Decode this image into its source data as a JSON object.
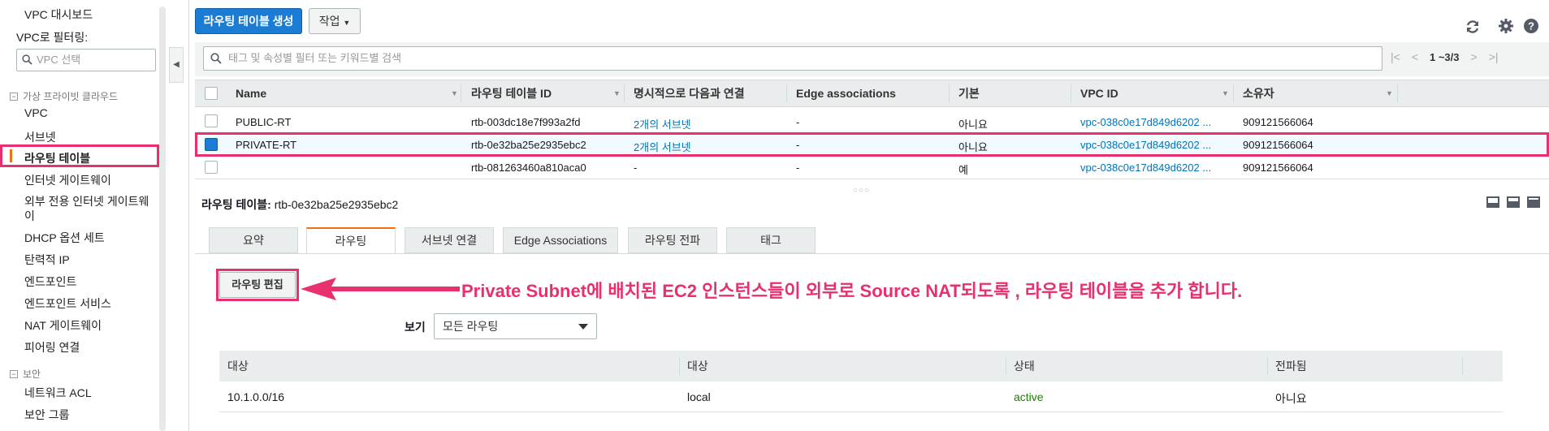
{
  "sidebar": {
    "top_item": "VPC 대시보드",
    "filter_label": "VPC로 필터링:",
    "filter_placeholder": "VPC 선택",
    "section_vpc": "가상 프라이빗 클라우드",
    "items": [
      "VPC",
      "서브넷",
      "라우팅 테이블",
      "인터넷 게이트웨이",
      "외부 전용 인터넷 게이트웨이",
      "DHCP 옵션 세트",
      "탄력적 IP",
      "엔드포인트",
      "엔드포인트 서비스",
      "NAT 게이트웨이",
      "피어링 연결"
    ],
    "section_security": "보안",
    "security_items": [
      "네트워크 ACL",
      "보안 그룹"
    ],
    "active_item": "라우팅 테이블"
  },
  "toolbar": {
    "create_label": "라우팅 테이블 생성",
    "action_label": "작업",
    "icons": [
      "refresh-icon",
      "gear-icon",
      "help-icon"
    ]
  },
  "search": {
    "placeholder": "태그 및 속성별 필터 또는 키워드별 검색",
    "pager_text": "1 ~3/3"
  },
  "table": {
    "columns": [
      "Name",
      "라우팅 테이블 ID",
      "명시적으로 다음과 연결",
      "Edge associations",
      "기본",
      "VPC ID",
      "소유자"
    ],
    "rows": [
      {
        "name": "PUBLIC-RT",
        "id": "rtb-003dc18e7f993a2fd",
        "explicit": "2개의 서브넷",
        "edge": "-",
        "main": "아니요",
        "vpc": "vpc-038c0e17d849d6202 ...",
        "owner": "909121566064",
        "selected": false
      },
      {
        "name": "PRIVATE-RT",
        "id": "rtb-0e32ba25e2935ebc2",
        "explicit": "2개의 서브넷",
        "edge": "-",
        "main": "아니요",
        "vpc": "vpc-038c0e17d849d6202 ...",
        "owner": "909121566064",
        "selected": true
      },
      {
        "name": "",
        "id": "rtb-081263460a810aca0",
        "explicit": "-",
        "edge": "-",
        "main": "예",
        "vpc": "vpc-038c0e17d849d6202 ...",
        "owner": "909121566064",
        "selected": false
      }
    ]
  },
  "detail": {
    "title_label": "라우팅 테이블:",
    "title_value": "rtb-0e32ba25e2935ebc2",
    "tabs": [
      "요약",
      "라우팅",
      "서브넷 연결",
      "Edge Associations",
      "라우팅 전파",
      "태그"
    ],
    "active_tab": "라우팅",
    "edit_button": "라우팅 편집",
    "annotation": "Private Subnet에 배치된 EC2 인스턴스들이 외부로 Source NAT되도록 , 라우팅 테이블을 추가 합니다.",
    "view_label": "보기",
    "view_value": "모든 라우팅",
    "routes_columns": [
      "대상",
      "대상",
      "상태",
      "전파됨"
    ],
    "routes": [
      {
        "destination": "10.1.0.0/16",
        "target": "local",
        "status": "active",
        "propagated": "아니요"
      }
    ]
  },
  "colors": {
    "highlight": "#e8306e",
    "primary": "#1a7cd2",
    "active_status": "#1d8102",
    "link": "#0073bb"
  }
}
